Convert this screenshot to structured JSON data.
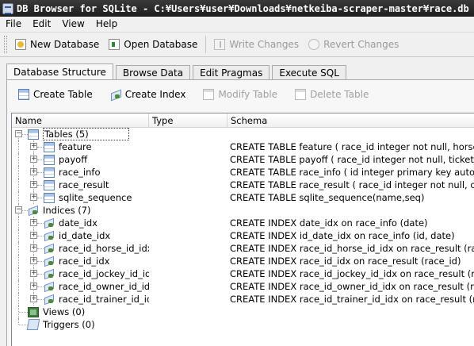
{
  "window": {
    "title": "DB Browser for SQLite - C:¥Users¥user¥Downloads¥netkeiba-scraper-master¥race.db"
  },
  "menu": [
    "File",
    "Edit",
    "View",
    "Help"
  ],
  "toolbar": {
    "new_database": "New Database",
    "open_database": "Open Database",
    "write_changes": "Write Changes",
    "revert_changes": "Revert Changes"
  },
  "tabs": [
    "Database Structure",
    "Browse Data",
    "Edit Pragmas",
    "Execute SQL"
  ],
  "active_tab": "Database Structure",
  "structure_toolbar": {
    "create_table": "Create Table",
    "create_index": "Create Index",
    "modify_table": "Modify Table",
    "delete_table": "Delete Table"
  },
  "tree": {
    "columns": {
      "name": "Name",
      "type": "Type",
      "schema": "Schema"
    },
    "tables_group": {
      "label": "Tables (5)",
      "items": [
        {
          "name": "feature",
          "schema": "CREATE TABLE feature ( race_id integer not null, horse_num"
        },
        {
          "name": "payoff",
          "schema": "CREATE TABLE payoff ( race_id integer not null, ticket_type"
        },
        {
          "name": "race_info",
          "schema": "CREATE TABLE race_info ( id integer primary key autoincre"
        },
        {
          "name": "race_result",
          "schema": "CREATE TABLE race_result ( race_id integer not null, order_"
        },
        {
          "name": "sqlite_sequence",
          "schema": "CREATE TABLE sqlite_sequence(name,seq)"
        }
      ]
    },
    "indices_group": {
      "label": "Indices (7)",
      "items": [
        {
          "name": "date_idx",
          "schema": "CREATE INDEX date_idx on race_info (date)"
        },
        {
          "name": "id_date_idx",
          "schema": "CREATE INDEX id_date_idx on race_info (id, date)"
        },
        {
          "name": "race_id_horse_id_idx",
          "schema": "CREATE INDEX race_id_horse_id_idx on race_result (race_id, h"
        },
        {
          "name": "race_id_idx",
          "schema": "CREATE INDEX race_id_idx on race_result (race_id)"
        },
        {
          "name": "race_id_jockey_id_idx",
          "schema": "CREATE INDEX race_id_jockey_id_idx on race_result (race_id, j"
        },
        {
          "name": "race_id_owner_id_idx",
          "schema": "CREATE INDEX race_id_owner_id_idx on race_result (race_id, o"
        },
        {
          "name": "race_id_trainer_id_idx",
          "schema": "CREATE INDEX race_id_trainer_id_idx on race_result (race_id, t"
        }
      ]
    },
    "views_group": {
      "label": "Views (0)"
    },
    "triggers_group": {
      "label": "Triggers (0)"
    }
  }
}
